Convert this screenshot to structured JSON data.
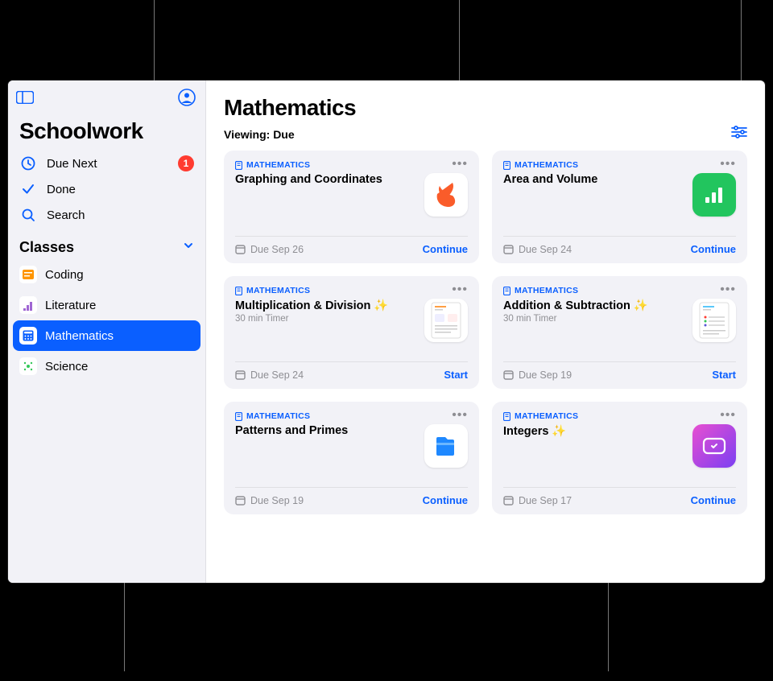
{
  "app_title": "Schoolwork",
  "sidebar": {
    "due_next": {
      "label": "Due Next",
      "badge": "1"
    },
    "done": {
      "label": "Done"
    },
    "search": {
      "label": "Search"
    },
    "classes_header": "Classes",
    "classes": [
      {
        "label": "Coding",
        "icon_color": "#ffcc00"
      },
      {
        "label": "Literature",
        "icon_color": "#a066d3"
      },
      {
        "label": "Mathematics",
        "icon_color": "#0a5fff",
        "selected": true
      },
      {
        "label": "Science",
        "icon_color": "#34c759"
      }
    ]
  },
  "main": {
    "title": "Mathematics",
    "viewing_label": "Viewing: Due"
  },
  "cards": [
    {
      "subject": "MATHEMATICS",
      "title": "Graphing and Coordinates",
      "subtitle": "",
      "due": "Due Sep 26",
      "action": "Continue",
      "thumb": "swift"
    },
    {
      "subject": "MATHEMATICS",
      "title": "Area and Volume",
      "subtitle": "",
      "due": "Due Sep 24",
      "action": "Continue",
      "thumb": "numbers"
    },
    {
      "subject": "MATHEMATICS",
      "title": "Multiplication & Division ✨",
      "subtitle": "30 min Timer",
      "due": "Due Sep 24",
      "action": "Start",
      "thumb": "sheet"
    },
    {
      "subject": "MATHEMATICS",
      "title": "Addition & Subtraction ✨",
      "subtitle": "30 min Timer",
      "due": "Due Sep 19",
      "action": "Start",
      "thumb": "sheet"
    },
    {
      "subject": "MATHEMATICS",
      "title": "Patterns and Primes",
      "subtitle": "",
      "due": "Due Sep 19",
      "action": "Continue",
      "thumb": "files"
    },
    {
      "subject": "MATHEMATICS",
      "title": "Integers ✨",
      "subtitle": "",
      "due": "Due Sep 17",
      "action": "Continue",
      "thumb": "clips"
    }
  ]
}
